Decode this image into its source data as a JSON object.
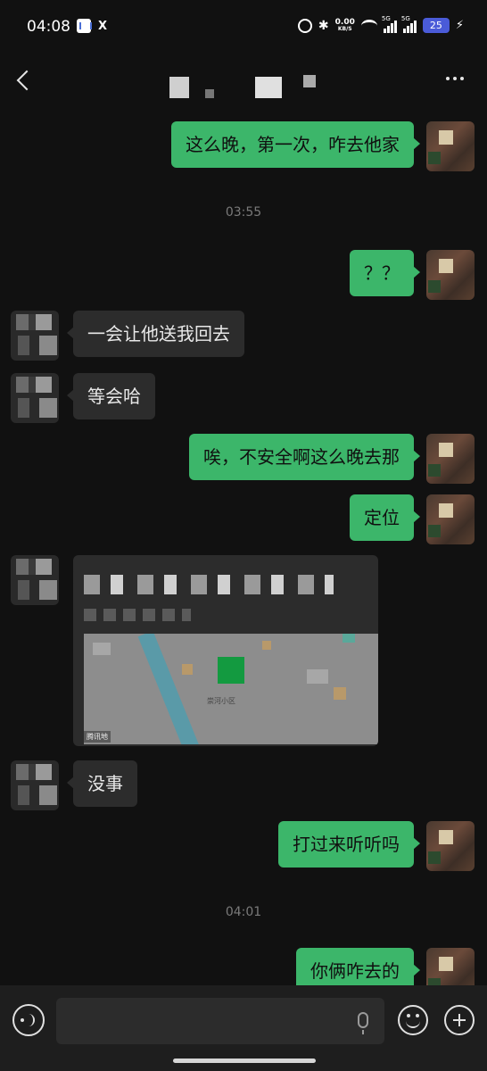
{
  "status_bar": {
    "time": "04:08",
    "x_label": "X",
    "net_speed": "0.00",
    "net_unit": "KB/S",
    "signal1": "5G",
    "signal2": "5G",
    "battery": "25"
  },
  "header": {
    "title": ""
  },
  "messages": [
    {
      "side": "out",
      "text": "这么晚，第一次，咋去他家"
    },
    {
      "type": "time",
      "text": "03:55"
    },
    {
      "side": "out",
      "text": "？？"
    },
    {
      "side": "in",
      "text": "一会让他送我回去"
    },
    {
      "side": "in",
      "text": "等会哈"
    },
    {
      "side": "out",
      "text": "唉，不安全啊这么晚去那"
    },
    {
      "side": "out",
      "text": "定位"
    },
    {
      "side": "in",
      "type": "location",
      "map_label": "崇河小区",
      "map_source": "腾讯地"
    },
    {
      "side": "in",
      "text": "没事"
    },
    {
      "side": "out",
      "text": "打过来听听吗"
    },
    {
      "type": "time",
      "text": "04:01"
    },
    {
      "side": "out",
      "text": "你俩咋去的"
    }
  ],
  "input": {
    "placeholder": ""
  },
  "colors": {
    "background": "#111111",
    "outgoing_bubble": "#3cb66a",
    "incoming_bubble": "#2c2c2c",
    "input_bar": "#1e1e1e",
    "battery": "#4a5bd8"
  },
  "icons": [
    "back-icon",
    "more-icon",
    "voice-icon",
    "mic-icon",
    "emoji-icon",
    "plus-icon"
  ]
}
